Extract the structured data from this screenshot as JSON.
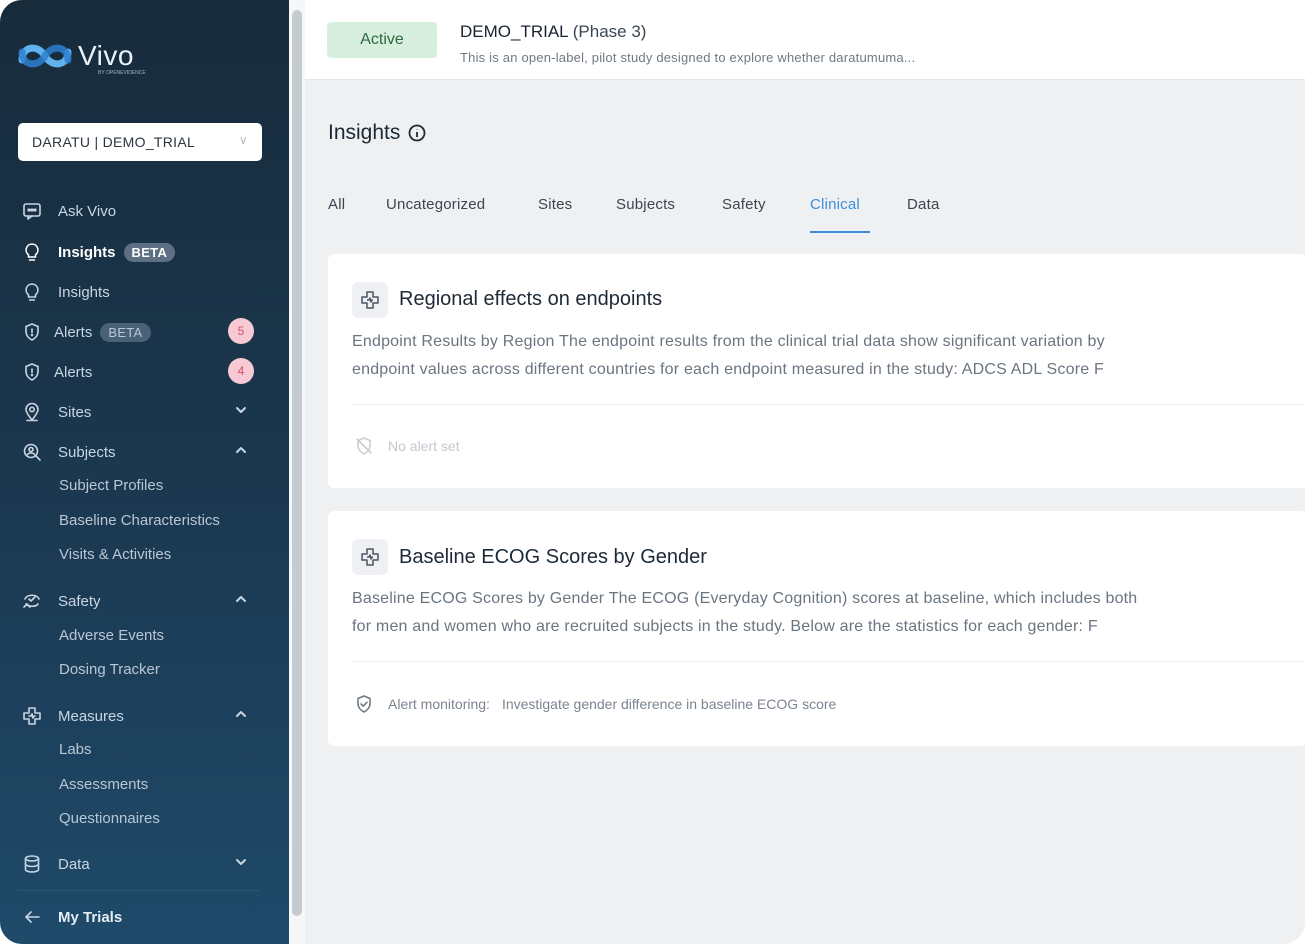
{
  "brand": {
    "name": "Vivo",
    "sub": "BY OPENEVIDENCE"
  },
  "trial_selector": {
    "value": "DARATU | DEMO_TRIAL"
  },
  "sidebar": {
    "items": [
      {
        "label": "Ask Vivo",
        "icon": "chat-icon"
      },
      {
        "label": "Insights",
        "badge": "BETA",
        "icon": "lightbulb-icon"
      },
      {
        "label": "Insights",
        "icon": "lightbulb-icon"
      },
      {
        "label": "Alerts",
        "badge": "BETA",
        "count": "5",
        "icon": "shield-icon"
      },
      {
        "label": "Alerts",
        "count": "4",
        "icon": "shield-icon"
      },
      {
        "label": "Sites",
        "icon": "location-pin-icon"
      },
      {
        "label": "Subjects",
        "icon": "search-person-icon"
      },
      {
        "label": "Safety",
        "icon": "safety-icon"
      },
      {
        "label": "Measures",
        "icon": "medical-cross-icon"
      },
      {
        "label": "Data",
        "icon": "database-icon"
      }
    ],
    "subjects_sub": [
      "Subject Profiles",
      "Baseline Characteristics",
      "Visits & Activities"
    ],
    "safety_sub": [
      "Adverse Events",
      "Dosing Tracker"
    ],
    "measures_sub": [
      "Labs",
      "Assessments",
      "Questionnaires"
    ],
    "back_label": "My Trials"
  },
  "header": {
    "status": "Active",
    "study_name": "DEMO_TRIAL",
    "phase": "(Phase 3)",
    "description": "This is an open-label, pilot study designed to explore whether daratumuma..."
  },
  "main": {
    "title": "Insights",
    "tabs": [
      "All",
      "Uncategorized",
      "Sites",
      "Subjects",
      "Safety",
      "Clinical",
      "Data"
    ],
    "active_tab": "Clinical",
    "cards": [
      {
        "title": "Regional effects on endpoints",
        "line1": "Endpoint Results by Region The endpoint results from the clinical trial data show significant variation by",
        "line2": "endpoint values across different countries for each endpoint measured in the study: ADCS ADL Score F",
        "alert_text": "No alert set"
      },
      {
        "title": "Baseline ECOG Scores by Gender",
        "line1": "Baseline ECOG Scores by Gender The ECOG (Everyday Cognition) scores at baseline, which includes both",
        "line2": "for men and women who are recruited subjects in the study. Below are the statistics for each gender: F",
        "alert_label": "Alert monitoring:",
        "alert_text": "Investigate gender difference in baseline ECOG score"
      }
    ]
  },
  "colors": {
    "sidebar_bg": "#1b3951",
    "accent": "#3d8fd8",
    "active_pill": "#d8efe0",
    "count_badge": "#f7c9d4"
  }
}
